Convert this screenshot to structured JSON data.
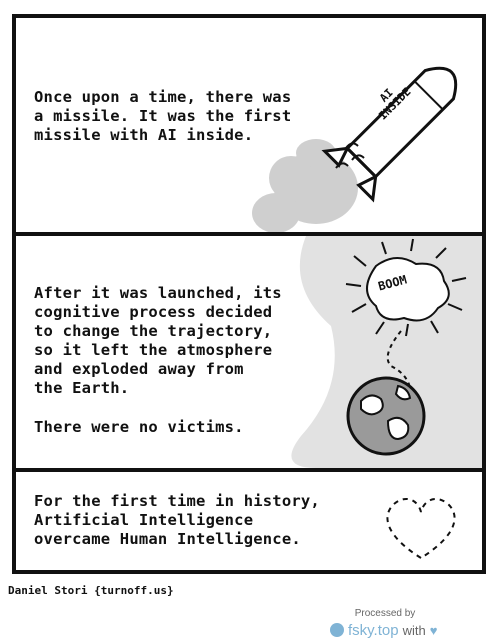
{
  "panels": [
    {
      "text": "Once upon a time, there was\na missile. It was the first\nmissile with AI inside."
    },
    {
      "text": "After it was launched, its\ncognitive process decided\nto change the trajectory,\nso it left the atmosphere\nand exploded away from\nthe Earth.",
      "text2": "There were no victims."
    },
    {
      "text": "For the first time in history,\nArtificial Intelligence\novercame Human Intelligence."
    }
  ],
  "missile_label": "AI\nINSIDE",
  "explosion_label": "BOOM",
  "credit": "Daniel Stori {turnoff.us}",
  "watermark": {
    "processed": "Processed by",
    "brand": "fsky.top",
    "with": "with",
    "heart": "♥"
  },
  "colors": {
    "ink": "#111111",
    "smoke": "#cfcfcf",
    "atmosphere": "#e2e2e2",
    "earth": "#9a9a9a",
    "brand": "#7fb3d5"
  }
}
